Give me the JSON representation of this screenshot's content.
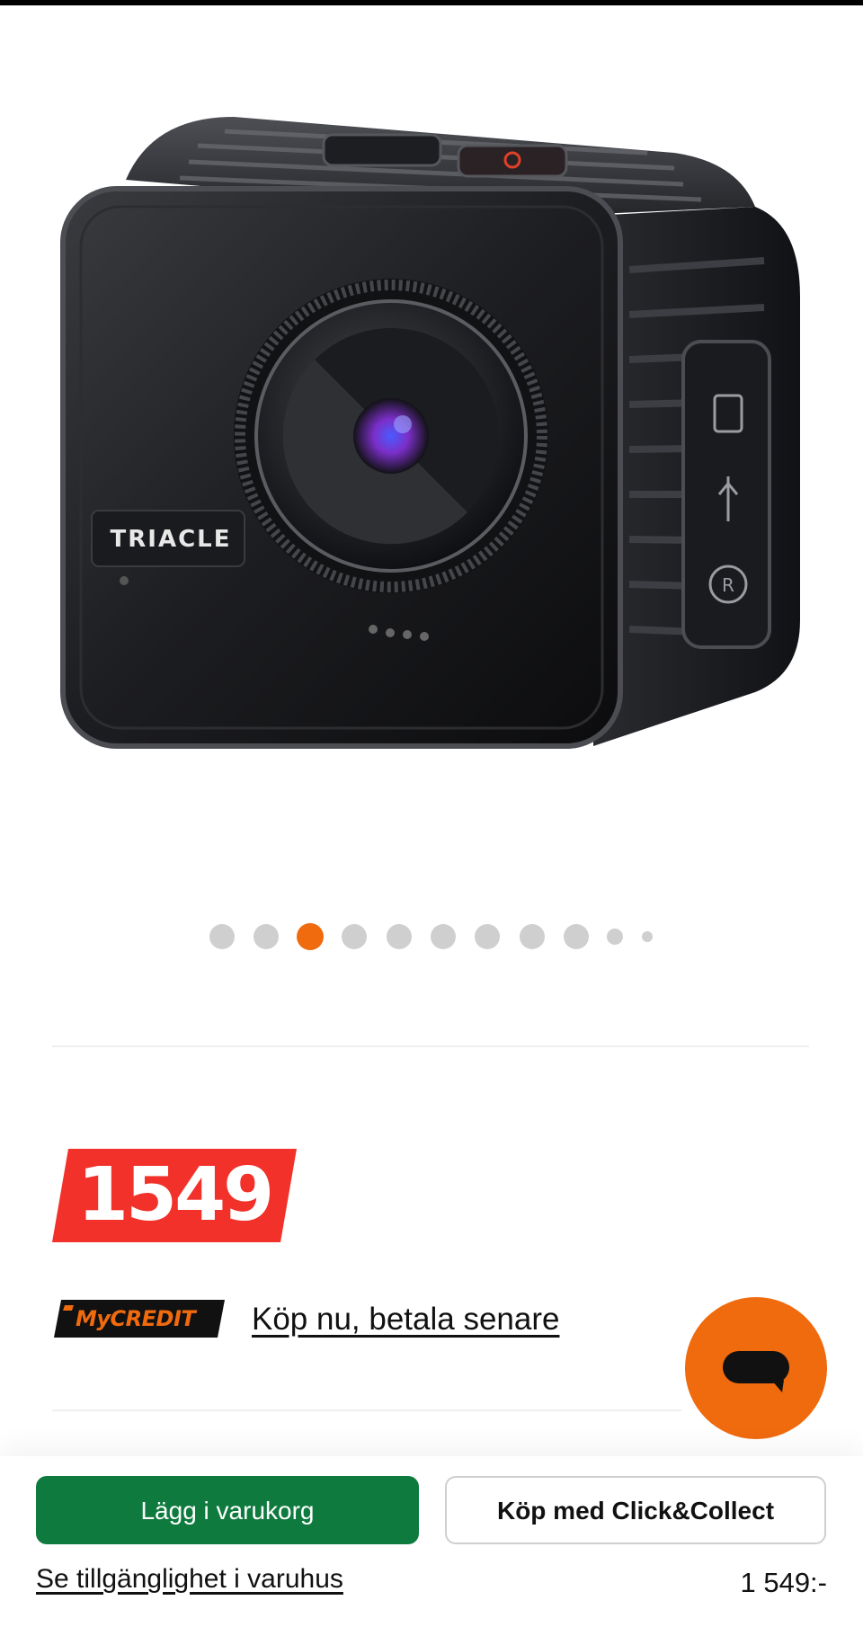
{
  "product": {
    "brand_logo": "TRIACLE",
    "image_alt": "Triacle action camera",
    "gallery": {
      "total": 11,
      "active_index": 2
    }
  },
  "price": {
    "badge": "1549",
    "badge_color": "#f2312a"
  },
  "financing": {
    "logo_text": "MyCREDIT",
    "link": "Köp nu, betala senare"
  },
  "chat": {
    "icon": "chat-bubble-icon",
    "color": "#f06a0e"
  },
  "bottom_bar": {
    "add_to_cart": "Lägg i varukorg",
    "click_collect": "Köp med Click&Collect",
    "store_availability": "Se tillgänglighet i varuhus",
    "price": "1 549:-",
    "primary_color": "#0e7a3e"
  }
}
